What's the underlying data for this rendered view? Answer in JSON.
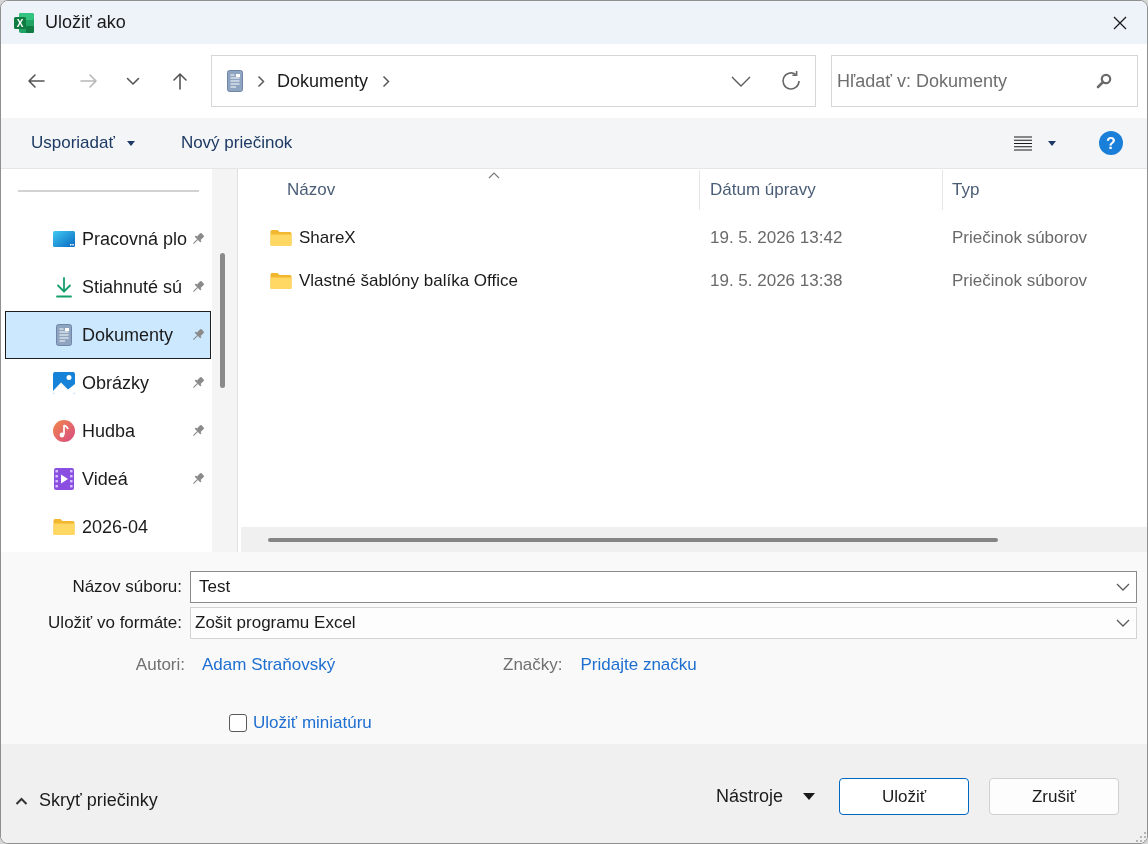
{
  "window": {
    "title": "Uložiť ako",
    "app_icon_letter": "X"
  },
  "navigation": {
    "buttons": [
      {
        "kind": "back",
        "disabled": false
      },
      {
        "kind": "forward",
        "disabled": true
      },
      {
        "kind": "recent",
        "disabled": false
      },
      {
        "kind": "up",
        "disabled": false
      }
    ],
    "address": {
      "path": [
        "Dokumenty"
      ]
    },
    "search": {
      "placeholder": "Hľadať v: Dokumenty"
    }
  },
  "toolbar": {
    "organize": "Usporiadať",
    "new_folder": "Nový priečinok",
    "help": "?"
  },
  "sidebar": {
    "items": [
      {
        "kind": "desktop",
        "label": "Pracovná plo",
        "pinned": true,
        "selected": false
      },
      {
        "kind": "downloads",
        "label": "Stiahnuté sú",
        "pinned": true,
        "selected": false
      },
      {
        "kind": "documents",
        "label": "Dokumenty",
        "pinned": true,
        "selected": true
      },
      {
        "kind": "pictures",
        "label": "Obrázky",
        "pinned": true,
        "selected": false
      },
      {
        "kind": "music",
        "label": "Hudba",
        "pinned": true,
        "selected": false
      },
      {
        "kind": "videos",
        "label": "Videá",
        "pinned": true,
        "selected": false
      },
      {
        "kind": "folder",
        "label": "2026-04",
        "pinned": false,
        "selected": false
      }
    ]
  },
  "file_list": {
    "columns": [
      {
        "label": "Názov",
        "sorted": true
      },
      {
        "label": "Dátum úpravy",
        "sorted": false
      },
      {
        "label": "Typ",
        "sorted": false
      }
    ],
    "rows": [
      {
        "name": "ShareX",
        "modified": "19. 5. 2026 13:42",
        "type": "Priečinok súborov",
        "selected": false
      },
      {
        "name": "Vlastné šablóny balíka Office",
        "modified": "19. 5. 2026 13:38",
        "type": "Priečinok súborov",
        "selected": false
      }
    ]
  },
  "save_form": {
    "file_name": {
      "label": "Názov súboru:",
      "value": "Test"
    },
    "file_type": {
      "label": "Uložiť vo formáte:",
      "value": "Zošit programu Excel"
    },
    "authors": {
      "label": "Autori:",
      "value": "Adam Straňovský"
    },
    "tags": {
      "label": "Značky:",
      "link": "Pridajte značku"
    },
    "thumbnail": {
      "label": "Uložiť miniatúru",
      "checked": false
    }
  },
  "footer": {
    "hide_folders": "Skryť priečinky",
    "tools": "Nástroje",
    "buttons": [
      {
        "label": "Uložiť",
        "kind": "primary"
      },
      {
        "label": "Zrušiť",
        "kind": "secondary"
      }
    ]
  }
}
